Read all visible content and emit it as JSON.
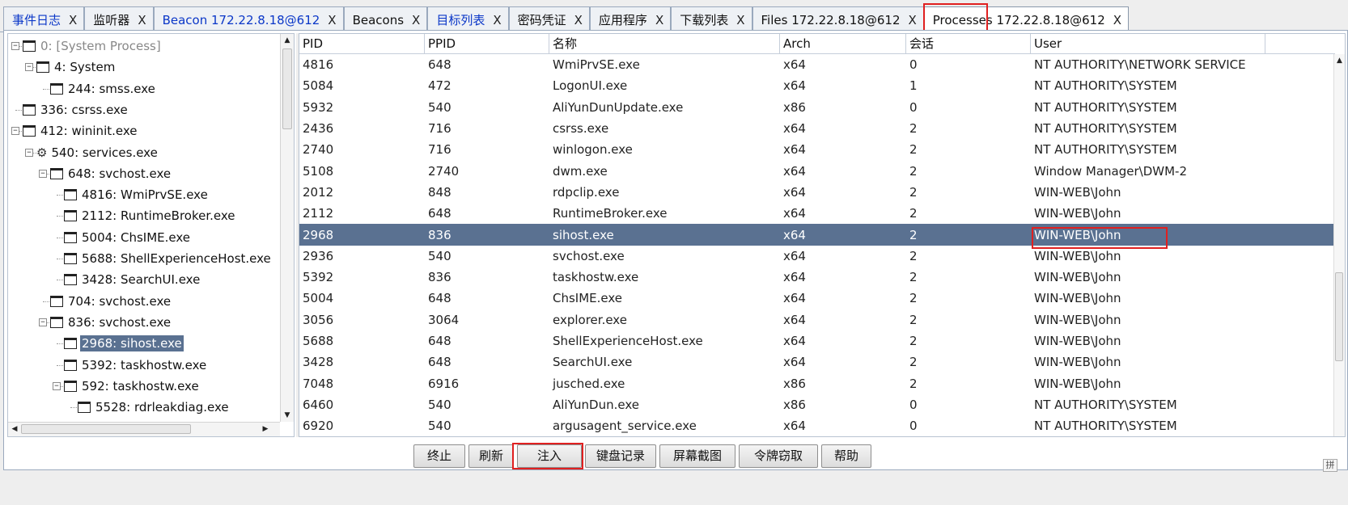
{
  "tabs": [
    {
      "label": "事件日志",
      "blue": true
    },
    {
      "label": "监听器",
      "blue": false
    },
    {
      "label": "Beacon 172.22.8.18@612",
      "blue": true
    },
    {
      "label": "Beacons",
      "blue": false
    },
    {
      "label": "目标列表",
      "blue": true
    },
    {
      "label": "密码凭证",
      "blue": false
    },
    {
      "label": "应用程序",
      "blue": false
    },
    {
      "label": "下载列表",
      "blue": false
    },
    {
      "label": "Files 172.22.8.18@612",
      "blue": false
    },
    {
      "label": "Processes 172.22.8.18@612",
      "blue": false,
      "active": true
    }
  ],
  "tab_close_glyph": "X",
  "tree": [
    {
      "label": "0: [System Process]",
      "depth": 0,
      "expander": "-",
      "icon": "window",
      "dim": true
    },
    {
      "label": "4: System",
      "depth": 1,
      "expander": "-",
      "icon": "window"
    },
    {
      "label": "244: smss.exe",
      "depth": 2,
      "expander": "",
      "icon": "window"
    },
    {
      "label": "336: csrss.exe",
      "depth": 0,
      "expander": "",
      "icon": "window"
    },
    {
      "label": "412: wininit.exe",
      "depth": 0,
      "expander": "-",
      "icon": "window"
    },
    {
      "label": "540: services.exe",
      "depth": 1,
      "expander": "-",
      "icon": "gear"
    },
    {
      "label": "648: svchost.exe",
      "depth": 2,
      "expander": "-",
      "icon": "window"
    },
    {
      "label": "4816: WmiPrvSE.exe",
      "depth": 3,
      "expander": "",
      "icon": "window"
    },
    {
      "label": "2112: RuntimeBroker.exe",
      "depth": 3,
      "expander": "",
      "icon": "window"
    },
    {
      "label": "5004: ChsIME.exe",
      "depth": 3,
      "expander": "",
      "icon": "window"
    },
    {
      "label": "5688: ShellExperienceHost.exe",
      "depth": 3,
      "expander": "",
      "icon": "window"
    },
    {
      "label": "3428: SearchUI.exe",
      "depth": 3,
      "expander": "",
      "icon": "window"
    },
    {
      "label": "704: svchost.exe",
      "depth": 2,
      "expander": "",
      "icon": "window"
    },
    {
      "label": "836: svchost.exe",
      "depth": 2,
      "expander": "-",
      "icon": "window"
    },
    {
      "label": "2968: sihost.exe",
      "depth": 3,
      "expander": "",
      "icon": "window",
      "selected": true
    },
    {
      "label": "5392: taskhostw.exe",
      "depth": 3,
      "expander": "",
      "icon": "window"
    },
    {
      "label": "592: taskhostw.exe",
      "depth": 3,
      "expander": "-",
      "icon": "window"
    },
    {
      "label": "5528: rdrleakdiag.exe",
      "depth": 4,
      "expander": "",
      "icon": "window"
    }
  ],
  "columns": [
    "PID",
    "PPID",
    "名称",
    "Arch",
    "会话",
    "User"
  ],
  "rows": [
    [
      "4816",
      "648",
      "WmiPrvSE.exe",
      "x64",
      "0",
      "NT AUTHORITY\\NETWORK SERVICE"
    ],
    [
      "5084",
      "472",
      "LogonUI.exe",
      "x64",
      "1",
      "NT AUTHORITY\\SYSTEM"
    ],
    [
      "5932",
      "540",
      "AliYunDunUpdate.exe",
      "x86",
      "0",
      "NT AUTHORITY\\SYSTEM"
    ],
    [
      "2436",
      "716",
      "csrss.exe",
      "x64",
      "2",
      "NT AUTHORITY\\SYSTEM"
    ],
    [
      "2740",
      "716",
      "winlogon.exe",
      "x64",
      "2",
      "NT AUTHORITY\\SYSTEM"
    ],
    [
      "5108",
      "2740",
      "dwm.exe",
      "x64",
      "2",
      "Window Manager\\DWM-2"
    ],
    [
      "2012",
      "848",
      "rdpclip.exe",
      "x64",
      "2",
      "WIN-WEB\\John"
    ],
    [
      "2112",
      "648",
      "RuntimeBroker.exe",
      "x64",
      "2",
      "WIN-WEB\\John"
    ],
    [
      "2968",
      "836",
      "sihost.exe",
      "x64",
      "2",
      "WIN-WEB\\John"
    ],
    [
      "2936",
      "540",
      "svchost.exe",
      "x64",
      "2",
      "WIN-WEB\\John"
    ],
    [
      "5392",
      "836",
      "taskhostw.exe",
      "x64",
      "2",
      "WIN-WEB\\John"
    ],
    [
      "5004",
      "648",
      "ChsIME.exe",
      "x64",
      "2",
      "WIN-WEB\\John"
    ],
    [
      "3056",
      "3064",
      "explorer.exe",
      "x64",
      "2",
      "WIN-WEB\\John"
    ],
    [
      "5688",
      "648",
      "ShellExperienceHost.exe",
      "x64",
      "2",
      "WIN-WEB\\John"
    ],
    [
      "3428",
      "648",
      "SearchUI.exe",
      "x64",
      "2",
      "WIN-WEB\\John"
    ],
    [
      "7048",
      "6916",
      "jusched.exe",
      "x86",
      "2",
      "WIN-WEB\\John"
    ],
    [
      "6460",
      "540",
      "AliYunDun.exe",
      "x86",
      "0",
      "NT AUTHORITY\\SYSTEM"
    ],
    [
      "6920",
      "540",
      "argusagent_service.exe",
      "x64",
      "0",
      "NT AUTHORITY\\SYSTEM"
    ]
  ],
  "selected_row": 8,
  "buttons": {
    "kill": "终止",
    "refresh": "刷新",
    "inject": "注入",
    "keylog": "键盘记录",
    "screenshot": "屏幕截图",
    "steal_token": "令牌窃取",
    "help": "帮助"
  },
  "ime_indicator": "拼",
  "colors": {
    "selection": "#5a7191",
    "highlight": "#e02020",
    "tab_link": "#0b37c8"
  }
}
